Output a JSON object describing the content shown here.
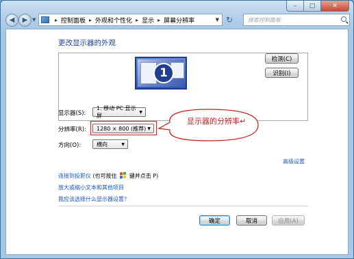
{
  "window": {
    "controls": {
      "minimize": "–",
      "maximize": "□",
      "close": "✕"
    }
  },
  "nav": {
    "breadcrumbs": [
      "控制面板",
      "外观和个性化",
      "显示",
      "屏幕分辨率"
    ],
    "search_placeholder": "搜索控制面板"
  },
  "main": {
    "title": "更改显示器的外观",
    "monitor_number": "1",
    "detect_label": "检测(C)",
    "identify_label": "识别(I)",
    "display_label": "显示器(S):",
    "display_value": "1. 移动 PC 显示屏",
    "resolution_label": "分辨率(R):",
    "resolution_value": "1280 × 800 (推荐)",
    "orientation_label": "方向(O):",
    "orientation_value": "横向",
    "callout_text": "显示器的分辨率↵",
    "advanced_link": "高级设置",
    "projector_link": "连接到投影仪",
    "projector_hint_prefix": " (也可按住 ",
    "projector_hint_suffix": " 键并点击 P)",
    "text_size_link": "放大或缩小文本和其他项目",
    "which_settings_link": "我应该选择什么显示器设置?"
  },
  "footer": {
    "ok_label": "确定",
    "cancel_label": "取消",
    "apply_label": "应用(A)"
  },
  "colors": {
    "accent": "#1e3f9c",
    "link": "#1e56c5",
    "callout": "#c71b1b",
    "highlight": "#d42424"
  }
}
